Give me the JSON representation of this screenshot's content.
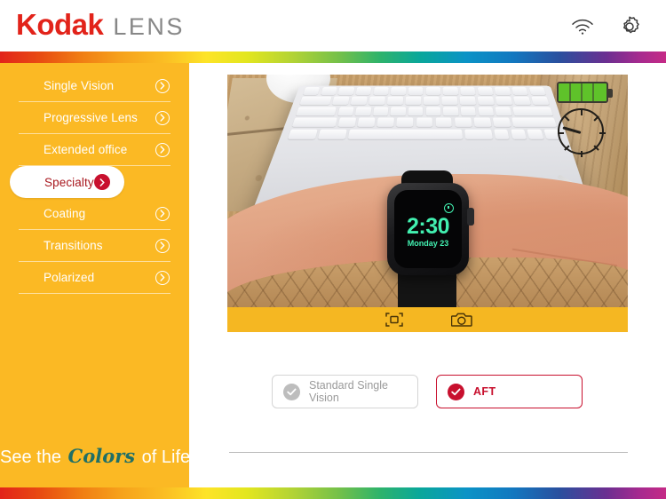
{
  "header": {
    "brand": "Kodak",
    "product": "LENS",
    "icons": [
      {
        "name": "wifi-icon",
        "label": "Wi-Fi"
      },
      {
        "name": "gear-icon",
        "label": "Settings"
      }
    ],
    "brand_color": "#E2231A",
    "product_color": "#878787"
  },
  "sidebar": {
    "background_color": "#FBB924",
    "active_index": 3,
    "items": [
      {
        "label": "Single Vision",
        "active": false
      },
      {
        "label": "Progressive Lens",
        "active": false
      },
      {
        "label": "Extended office",
        "active": false
      },
      {
        "label": "Specialty",
        "active": true
      },
      {
        "label": "Coating",
        "active": false
      },
      {
        "label": "Transitions",
        "active": false
      },
      {
        "label": "Polarized",
        "active": false
      }
    ],
    "tagline": {
      "part1": "See the",
      "script": "Colors",
      "part2": "of Life",
      "script_color": "#1F6F66"
    }
  },
  "preview": {
    "scene_description": "Wrist with smartwatch over a laptop keyboard on a wooden desk",
    "watch": {
      "time": "2:30",
      "date": "Monday 23",
      "screen_color": "#42f0b0",
      "alarm_icon": "alarm-icon"
    },
    "overlay": {
      "battery_icon": "battery-full-icon",
      "battery_color": "#5fc22a",
      "dial_icon": "clock-dial-icon"
    },
    "toolbar": {
      "background_color": "#F5B722",
      "buttons": [
        {
          "name": "focus-frame-icon",
          "label": "Focus"
        },
        {
          "name": "camera-icon",
          "label": "Capture"
        }
      ]
    }
  },
  "options": [
    {
      "label": "Standard Single Vision",
      "selected": false,
      "check_color": "#BDBDBD",
      "border_color": "#d4d4d4",
      "text_color": "#9A9A9A"
    },
    {
      "label": "AFT",
      "selected": true,
      "check_color": "#C8102E",
      "border_color": "#C8102E",
      "text_color": "#C8102E"
    }
  ],
  "keyboard_rows": [
    [
      "k",
      "k",
      "k",
      "k",
      "k",
      "k",
      "k",
      "k",
      "k",
      "k",
      "k",
      "k",
      "k",
      "k"
    ],
    [
      "w2",
      "k",
      "k",
      "k",
      "k",
      "k",
      "k",
      "k",
      "k",
      "k",
      "k",
      "k",
      "k",
      "k"
    ],
    [
      "w3",
      "k",
      "k",
      "k",
      "k",
      "k",
      "k",
      "k",
      "k",
      "k",
      "k",
      "k",
      "w3"
    ],
    [
      "w3",
      "k",
      "k",
      "k",
      "k",
      "k",
      "k",
      "k",
      "k",
      "k",
      "k",
      "w3"
    ],
    [
      "w2",
      "w2",
      "sp",
      "w2",
      "k",
      "k",
      "k",
      "k"
    ]
  ]
}
